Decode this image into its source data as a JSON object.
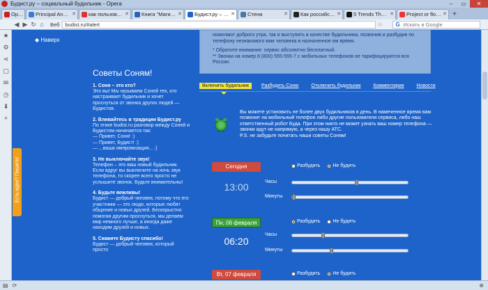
{
  "window": {
    "title": "Будист.ру – социальный будильник - Opera"
  },
  "tabs": [
    {
      "label": "Opera",
      "color": "#c8201a"
    },
    {
      "label": "Principal Analyst ...",
      "color": "#3a7bd5"
    },
    {
      "label": "как пользоватьс...",
      "color": "#d33"
    },
    {
      "label": "Книга \"Магия Pi...",
      "color": "#2a64b6"
    },
    {
      "label": "Будист.ру – соци...",
      "color": "#1d63c9",
      "active": true
    },
    {
      "label": "Стена",
      "color": "#4a76a8"
    },
    {
      "label": "Как российский ...",
      "color": "#222"
    },
    {
      "label": "5 Trends That Wil...",
      "color": "#111"
    },
    {
      "label": "Project or flow? I...",
      "color": "#e33"
    }
  ],
  "address": {
    "badge": "Веб",
    "url": "budist.ru/#alert",
    "search_placeholder": "Искать в Google"
  },
  "page": {
    "back_to_top": "Наверх",
    "info": {
      "text1": "пожелают доброго утра, так и выступить в качестве будильника, позвонив    и разбудив по",
      "text2": "телефону незнакомого вам человека в назначенное им время.",
      "note1": "* Обратите внимание: сервис абсолютно бесплатный.",
      "note2": "** Звонки на номер 8 (800) 555-555-7 с мобильных телефонов не тарифицируются вся России."
    },
    "tabs": [
      {
        "label": "Включить будильник",
        "active": true
      },
      {
        "label": "Разбудить Соню"
      },
      {
        "label": "Отключить будильник"
      },
      {
        "label": "Комментарии"
      },
      {
        "label": "Новости"
      }
    ],
    "intro": "Вы можете установить не более двух будильников в день. В намеченное время вам позвонит на мобильный телефон либо другие пользователи сервиса, либо наш ответственный робот Буда. При этом никто не может узнать ваш номер телефона — звонки идут не напрямую, а через нашу АТС.",
    "intro_ps": "P.S. не забудьте почитать наши советы Соням!",
    "tips_title": "Советы Соням!",
    "tips": [
      {
        "title": "1. Соня – это кто?",
        "text": "Это вы! Мы называем Соней тех, кто настраивает будильник и хочет проснуться от звонка других людей — Будистов."
      },
      {
        "title": "2. Вливайтесь в традиции Будист.ру",
        "text": "По этике budist.ru разговор между Соней и Будистом начинается так:\n— Привет, Соня! :)\n— Привет, Будист! :)\n— ...ваша импровизация... :)"
      },
      {
        "title": "3. Не выключайте звук!",
        "text": "Телефон – это ваш новый будильник. Если вдруг вы выключите на ночь звук телефона, то скорее всего просто не услышите звонок. Будьте внимательны!"
      },
      {
        "title": "4. Будьте вежливы!",
        "text": "Будист — добрый человек, потому что его участники — это люди, которые любят общение и новых друзей. Бескорыстно помогая другим проснуться, мы делаем мир немного лучше, а иногда даже находим друзей и новых."
      },
      {
        "title": "5. Скажите Будисту спасибо!",
        "text": "Будист — добрый человек, который просто"
      }
    ],
    "ideas_label": "Есть идеи? Пишите!",
    "days": [
      {
        "label": "Сегодня",
        "style": "red",
        "time": "13:00",
        "dim": true,
        "wake": "Разбудить",
        "nowake": "Не будить",
        "selected": "nowake",
        "hours_label": "Часы",
        "minutes_label": "Минуты",
        "hours_value": 13,
        "minutes_value": 0
      },
      {
        "label": "Пн, 06 февраля",
        "style": "green",
        "time": "06:20",
        "dim": false,
        "wake": "Разбудить",
        "nowake": "Не будить",
        "selected": "wake",
        "hours_label": "Часы",
        "minutes_label": "Минуты",
        "hours_value": 6,
        "minutes_value": 20
      },
      {
        "label": "Вт, 07 февраля",
        "style": "red",
        "wake": "Разбудить",
        "nowake": "Не будить",
        "selected": "nowake"
      }
    ]
  }
}
